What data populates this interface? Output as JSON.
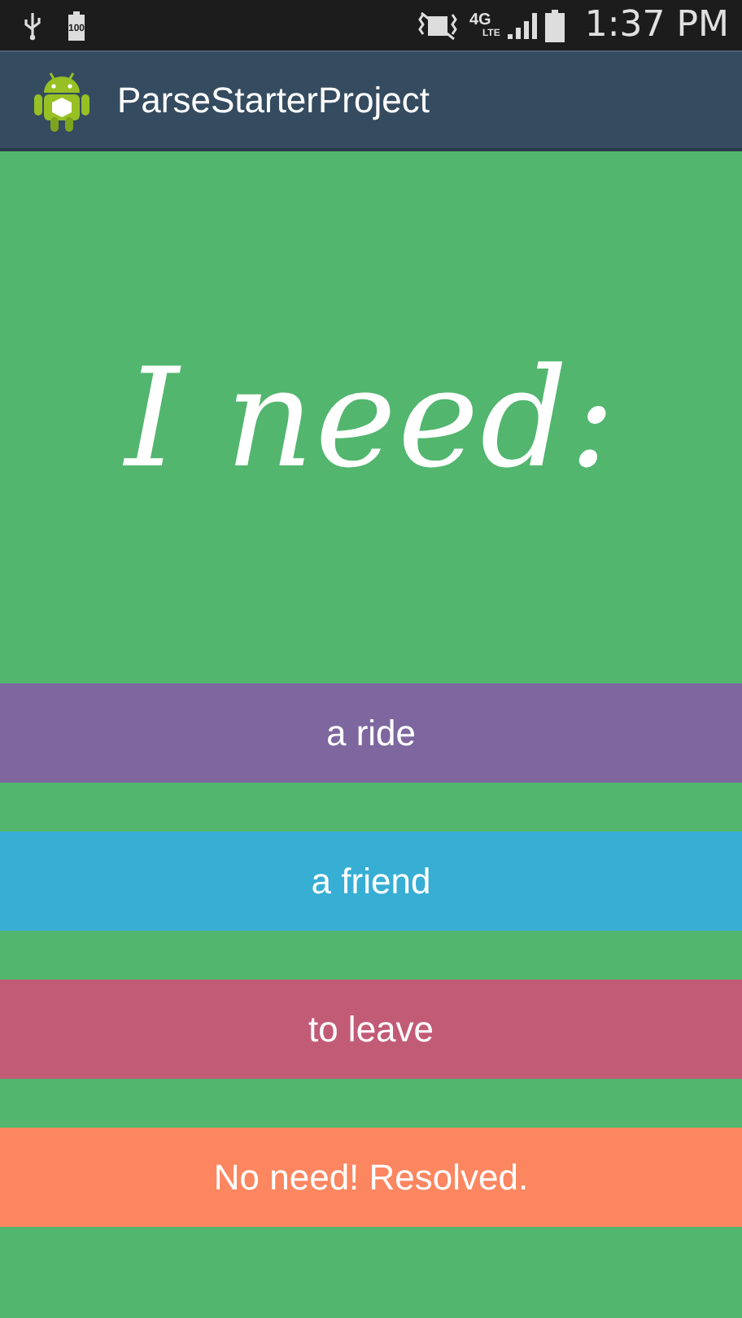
{
  "status_bar": {
    "battery_level_text": "100",
    "network": "4G",
    "network_sub": "LTE",
    "time": "1:37 PM"
  },
  "action_bar": {
    "title": "ParseStarterProject"
  },
  "heading": "I need:",
  "options": [
    {
      "label": "a ride",
      "color": "#7d679e"
    },
    {
      "label": "a friend",
      "color": "#37aed4"
    },
    {
      "label": "to leave",
      "color": "#c25b76"
    },
    {
      "label": "No need! Resolved.",
      "color": "#fb8660"
    }
  ]
}
